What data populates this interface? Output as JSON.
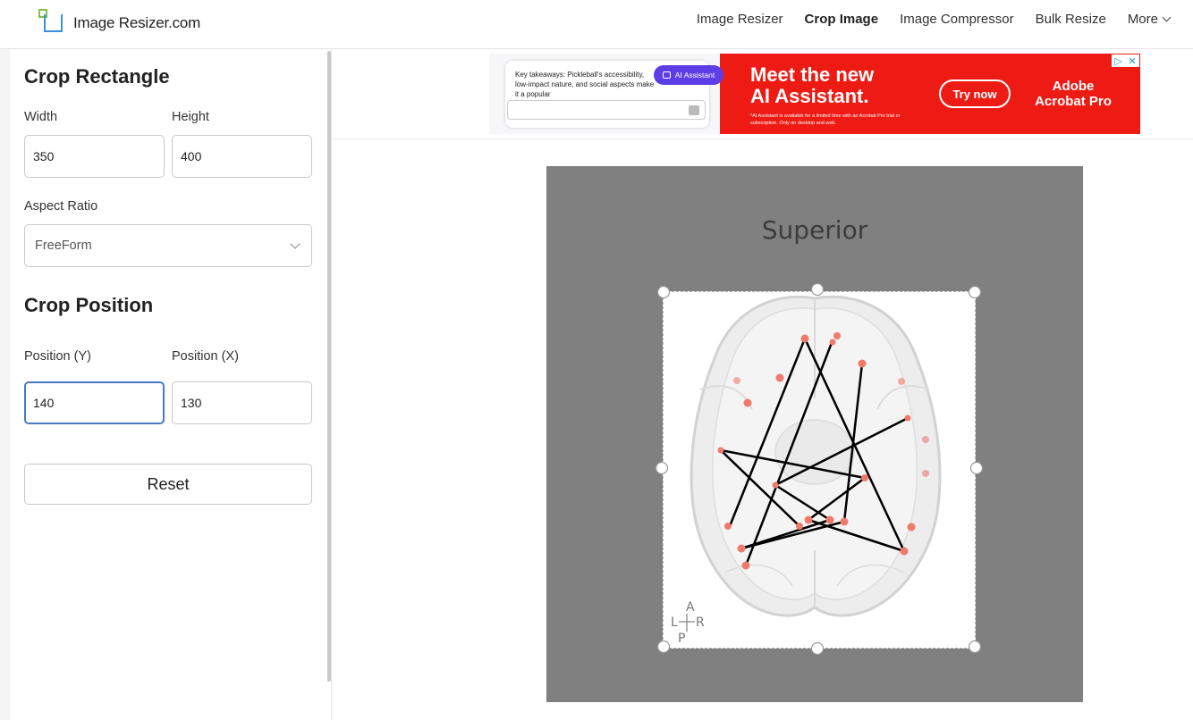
{
  "header": {
    "logo_text": "Image Resizer.com",
    "nav": [
      "Image Resizer",
      "Crop Image",
      "Image Compressor",
      "Bulk Resize",
      "More"
    ]
  },
  "sidebar": {
    "crop_rect_title": "Crop Rectangle",
    "width_label": "Width",
    "width_value": "350",
    "height_label": "Height",
    "height_value": "400",
    "aspect_label": "Aspect Ratio",
    "aspect_value": "FreeForm",
    "crop_pos_title": "Crop Position",
    "pos_y_label": "Position (Y)",
    "pos_y_value": "140",
    "pos_x_label": "Position (X)",
    "pos_x_value": "130",
    "reset_label": "Reset"
  },
  "ad": {
    "chat_text": "Key takeaways: Pickleball's accessibility, low-impact nature, and social aspects make it a popular",
    "pill_text": "AI Assistant",
    "headline_1": "Meet the new",
    "headline_2": "AI Assistant.",
    "fine_print": "*AI Assistant is available for a limited time with an Acrobat Pro trial or subscription. Only on desktop and web.",
    "cta": "Try now",
    "brand_1": "Adobe",
    "brand_2": "Acrobat Pro"
  },
  "canvas": {
    "view_label": "Superior",
    "orient": {
      "a": "A",
      "l": "L",
      "r": "R",
      "p": "P"
    }
  }
}
